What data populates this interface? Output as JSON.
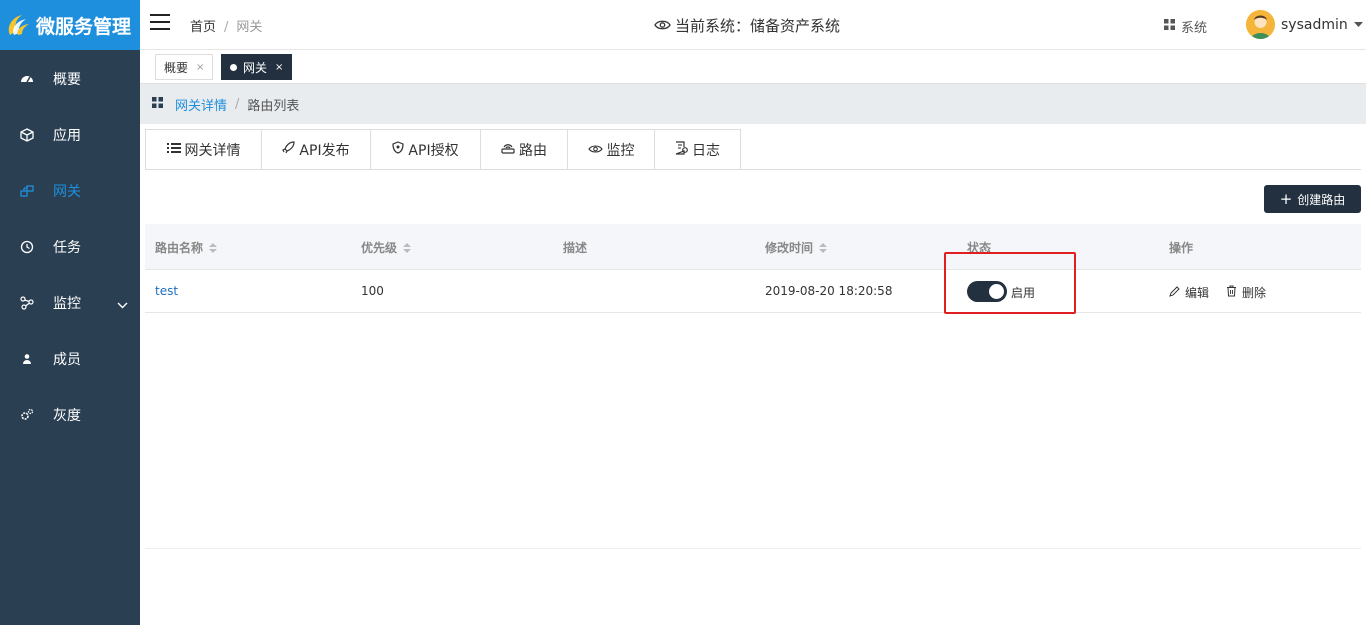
{
  "app": {
    "title": "微服务管理"
  },
  "sidebar": {
    "items": [
      {
        "label": "概要",
        "icon": "dashboard-icon"
      },
      {
        "label": "应用",
        "icon": "cube-icon"
      },
      {
        "label": "网关",
        "icon": "gateway-icon",
        "active": true
      },
      {
        "label": "任务",
        "icon": "clock-icon"
      },
      {
        "label": "监控",
        "icon": "monitor-icon",
        "has_submenu": true
      },
      {
        "label": "成员",
        "icon": "user-icon"
      },
      {
        "label": "灰度",
        "icon": "gears-icon"
      }
    ]
  },
  "header": {
    "breadcrumb": {
      "home": "首页",
      "separator": "/",
      "current": "网关"
    },
    "current_system": "当前系统：储备资产系统",
    "system_label": "系统",
    "username": "sysadmin"
  },
  "tabs": [
    {
      "label": "概要",
      "close": "×"
    },
    {
      "label": "网关",
      "close": "×",
      "active": true
    }
  ],
  "subcrumb": {
    "parent": "网关详情",
    "separator": "/",
    "current": "路由列表"
  },
  "content_tabs": [
    {
      "label": "网关详情",
      "icon": "list-icon"
    },
    {
      "label": "API发布",
      "icon": "rocket-icon"
    },
    {
      "label": "API授权",
      "icon": "shield-icon"
    },
    {
      "label": "路由",
      "icon": "router-icon",
      "active": true
    },
    {
      "label": "监控",
      "icon": "eye-icon"
    },
    {
      "label": "日志",
      "icon": "log-icon"
    }
  ],
  "create_button": {
    "label": "创建路由"
  },
  "table": {
    "headers": [
      "路由名称",
      "优先级",
      "描述",
      "修改时间",
      "状态",
      "操作"
    ],
    "rows": [
      {
        "name": "test",
        "priority": "100",
        "description": "",
        "modified": "2019-08-20 18:20:58",
        "status_label": "启用",
        "status_on": true,
        "edit_label": "编辑",
        "delete_label": "删除"
      }
    ]
  },
  "colors": {
    "sidebar_bg": "#2b3f53",
    "logo_bg": "#1e8fdc",
    "accent": "#1e8fdc",
    "dark": "#22303f",
    "highlight": "#e02020"
  }
}
